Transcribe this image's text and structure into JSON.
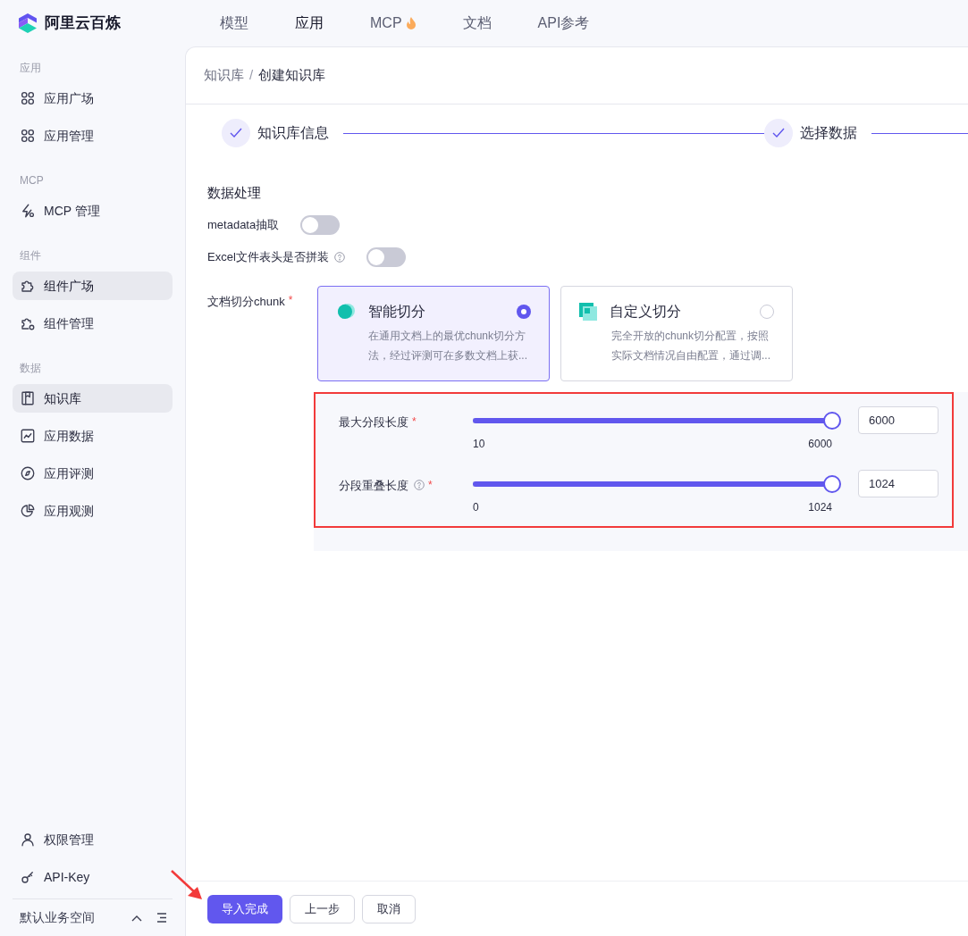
{
  "brand": {
    "name": "阿里云百炼"
  },
  "nav": [
    {
      "label": "模型",
      "selected": false,
      "hot": false
    },
    {
      "label": "应用",
      "selected": true,
      "hot": false
    },
    {
      "label": "MCP",
      "selected": false,
      "hot": true
    },
    {
      "label": "文档",
      "selected": false,
      "hot": false
    },
    {
      "label": "API参考",
      "selected": false,
      "hot": false
    }
  ],
  "sidebar": {
    "groups": [
      {
        "title": "应用",
        "items": [
          {
            "label": "应用广场",
            "selected": false
          },
          {
            "label": "应用管理",
            "selected": false
          }
        ]
      },
      {
        "title": "MCP",
        "items": [
          {
            "label": "MCP 管理",
            "selected": false
          }
        ]
      },
      {
        "title": "组件",
        "items": [
          {
            "label": "组件广场",
            "selected": true
          },
          {
            "label": "组件管理",
            "selected": false
          }
        ]
      },
      {
        "title": "数据",
        "items": [
          {
            "label": "知识库",
            "selected": true
          },
          {
            "label": "应用数据",
            "selected": false
          },
          {
            "label": "应用评测",
            "selected": false
          },
          {
            "label": "应用观测",
            "selected": false
          }
        ]
      }
    ],
    "bottom_items": [
      {
        "label": "权限管理"
      },
      {
        "label": "API-Key"
      }
    ],
    "workspace": "默认业务空间"
  },
  "breadcrumb": {
    "items": [
      "知识库",
      "创建知识库"
    ],
    "separator": "/"
  },
  "steps": [
    {
      "label": "知识库信息",
      "done": true
    },
    {
      "label": "选择数据",
      "done": true
    }
  ],
  "section_title": "数据处理",
  "required_mark": "*",
  "switches": [
    {
      "label": "metadata抽取",
      "help": false,
      "on": false
    },
    {
      "label": "Excel文件表头是否拼装",
      "help": true,
      "on": false
    }
  ],
  "chunk": {
    "label": "文档切分chunk",
    "required": true,
    "options": [
      {
        "title": "智能切分",
        "description": "在通用文档上的最优chunk切分方法，经过评测可在多数文档上获...",
        "selected": true
      },
      {
        "title": "自定义切分",
        "description": "完全开放的chunk切分配置，按照实际文档情况自由配置，通过调...",
        "selected": false
      }
    ]
  },
  "sliders": [
    {
      "label": "最大分段长度",
      "help": false,
      "required": true,
      "min": "10",
      "max": "6000",
      "level": 1,
      "value": "6000"
    },
    {
      "label": "分段重叠长度",
      "help": true,
      "required": true,
      "min": "0",
      "max": "1024",
      "level": 1,
      "value": "1024"
    }
  ],
  "buttons": [
    {
      "label": "导入完成",
      "kind": "primary"
    },
    {
      "label": "上一步",
      "kind": "default"
    },
    {
      "label": "取消",
      "kind": "default"
    }
  ]
}
